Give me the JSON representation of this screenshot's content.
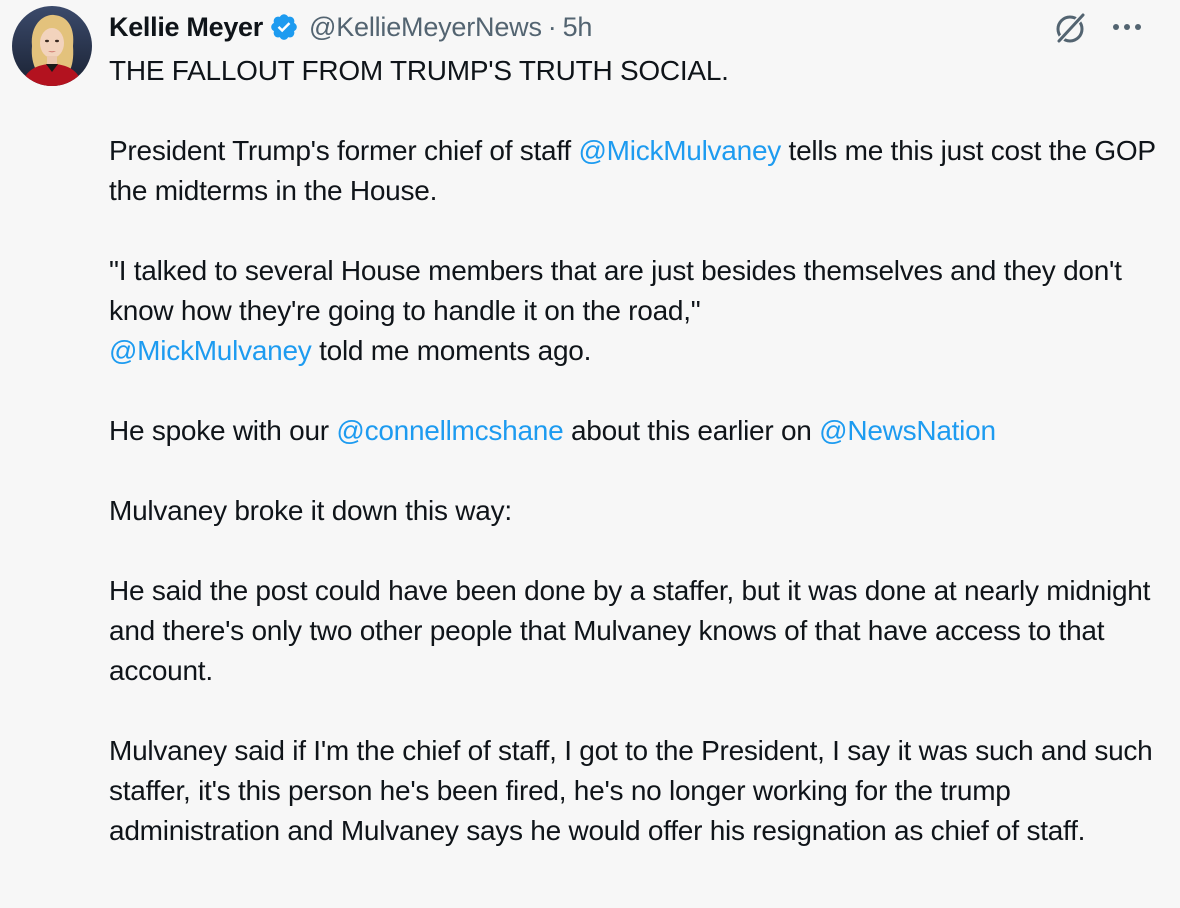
{
  "author": {
    "display_name": "Kellie Meyer",
    "handle": "@KellieMeyerNews",
    "separator": "·",
    "time": "5h",
    "verified_icon": "verified-badge-icon",
    "avatar_icon": "avatar-photo"
  },
  "actions": {
    "grok_icon": "grok-icon",
    "more_icon": "more-options-icon"
  },
  "colors": {
    "link": "#1d9bf0",
    "text": "#0f1419",
    "secondary_text": "#536471",
    "background": "#f7f7f7"
  },
  "tweet": {
    "p1": "THE FALLOUT FROM TRUMP'S TRUTH SOCIAL.",
    "p2": {
      "before": "President Trump's former chief of staff ",
      "mention": "@MickMulvaney",
      "after": " tells me this just cost the GOP the midterms in the House."
    },
    "p3": {
      "before": "\"I talked to several House members that are just besides themselves and they don't know how they're going to handle it on the road,\" ",
      "mention": "@MickMulvaney",
      "after": " told me moments ago."
    },
    "p4": {
      "before": "He spoke with our ",
      "mention1": "@connellmcshane",
      "middle": " about this earlier on ",
      "mention2": "@NewsNation"
    },
    "p5": "Mulvaney broke it down this way:",
    "p6": "He said the post could have been done by a staffer, but it was done at nearly midnight and there's only two other people that Mulvaney knows of that have access to that account.",
    "p7": "Mulvaney said if I'm the chief of staff, I got to the President, I say it was such and such staffer, it's this person he's been fired, he's no longer working for the trump administration and Mulvaney says he would offer his resignation as chief of staff."
  }
}
